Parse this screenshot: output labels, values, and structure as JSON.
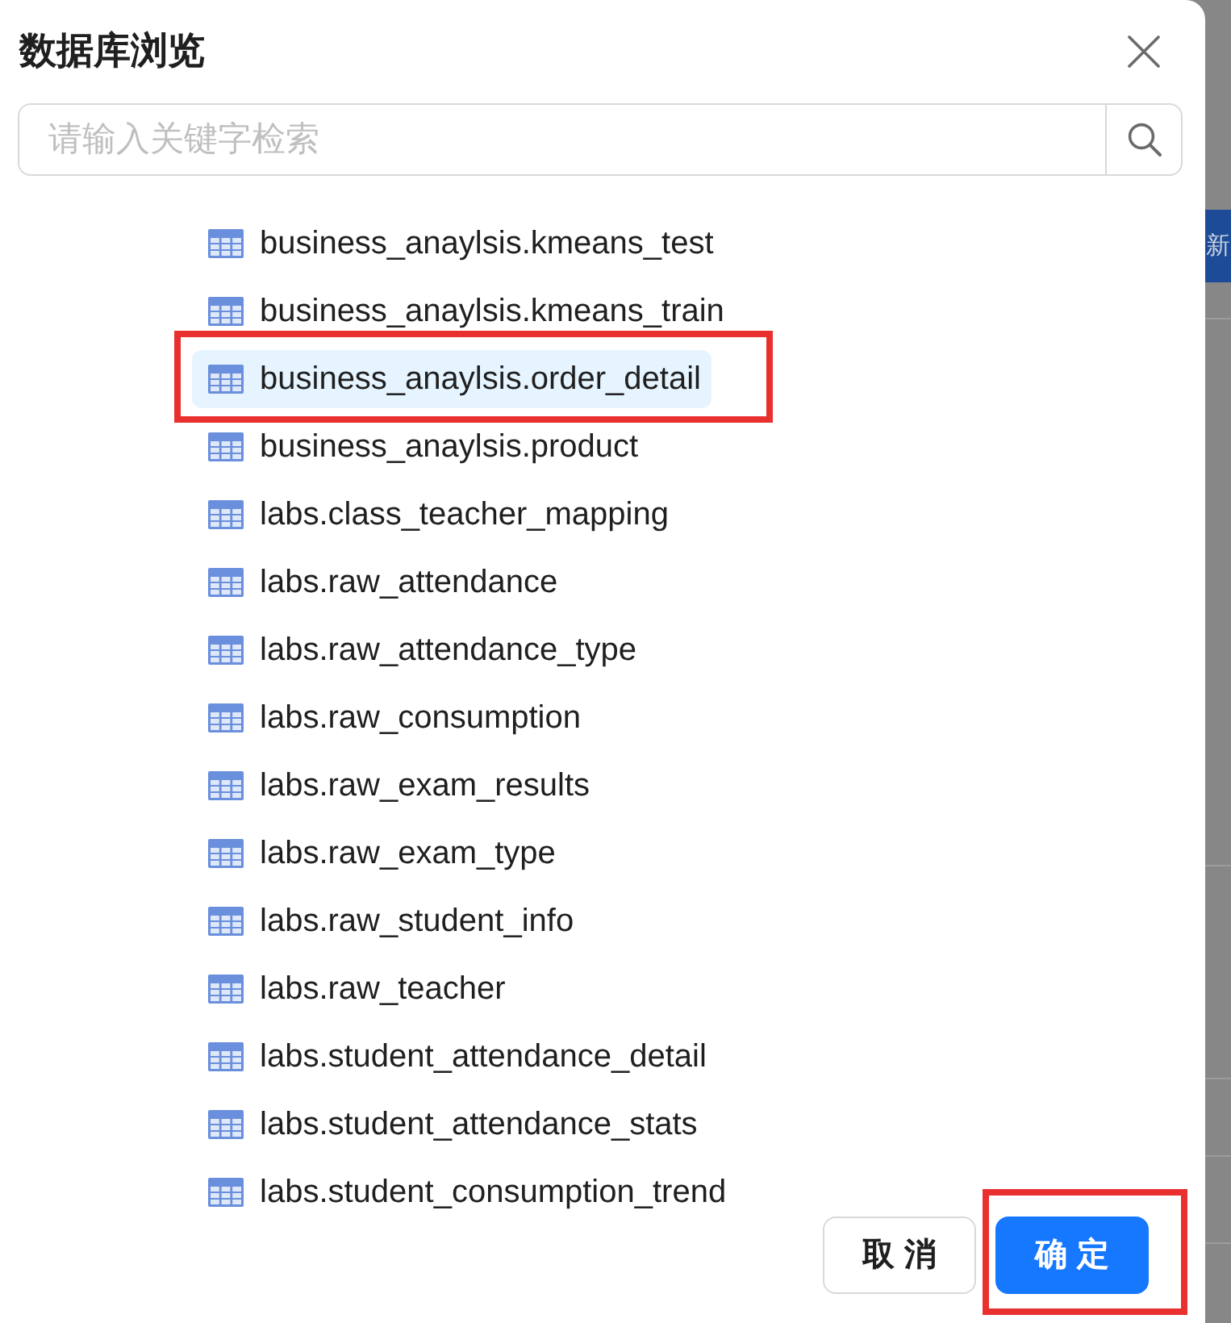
{
  "dialog": {
    "title": "数据库浏览",
    "search": {
      "placeholder": "请输入关键字检索"
    },
    "tables": [
      {
        "name": "business_anaylsis.kmeans_test",
        "selected": false,
        "highlighted": false
      },
      {
        "name": "business_anaylsis.kmeans_train",
        "selected": false,
        "highlighted": false
      },
      {
        "name": "business_anaylsis.order_detail",
        "selected": true,
        "highlighted": true
      },
      {
        "name": "business_anaylsis.product",
        "selected": false,
        "highlighted": false
      },
      {
        "name": "labs.class_teacher_mapping",
        "selected": false,
        "highlighted": false
      },
      {
        "name": "labs.raw_attendance",
        "selected": false,
        "highlighted": false
      },
      {
        "name": "labs.raw_attendance_type",
        "selected": false,
        "highlighted": false
      },
      {
        "name": "labs.raw_consumption",
        "selected": false,
        "highlighted": false
      },
      {
        "name": "labs.raw_exam_results",
        "selected": false,
        "highlighted": false
      },
      {
        "name": "labs.raw_exam_type",
        "selected": false,
        "highlighted": false
      },
      {
        "name": "labs.raw_student_info",
        "selected": false,
        "highlighted": false
      },
      {
        "name": "labs.raw_teacher",
        "selected": false,
        "highlighted": false
      },
      {
        "name": "labs.student_attendance_detail",
        "selected": false,
        "highlighted": false
      },
      {
        "name": "labs.student_attendance_stats",
        "selected": false,
        "highlighted": false
      },
      {
        "name": "labs.student_consumption_trend",
        "selected": false,
        "highlighted": false
      }
    ],
    "buttons": [
      {
        "label": "取 消",
        "kind": "default",
        "highlighted": false
      },
      {
        "label": "确 定",
        "kind": "primary",
        "highlighted": true
      }
    ]
  },
  "background": {
    "button_label": "新"
  }
}
